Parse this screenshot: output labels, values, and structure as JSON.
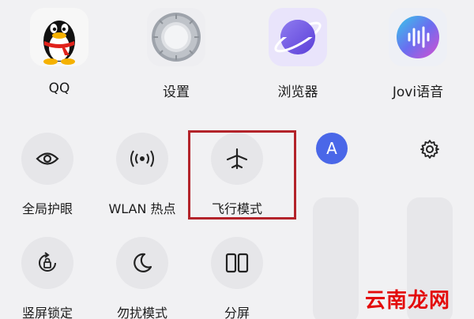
{
  "apps": [
    {
      "label": "QQ",
      "icon": "qq-penguin-icon"
    },
    {
      "label": "设置",
      "icon": "settings-gear-icon"
    },
    {
      "label": "浏览器",
      "icon": "browser-planet-icon"
    },
    {
      "label": "Jovi语音",
      "icon": "jovi-voice-icon"
    }
  ],
  "tiles": [
    {
      "label": "全局护眼",
      "icon": "eye-icon"
    },
    {
      "label": "WLAN 热点",
      "icon": "hotspot-icon"
    },
    {
      "label": "飞行模式",
      "icon": "airplane-icon"
    },
    {
      "label": "竖屏锁定",
      "icon": "rotation-lock-icon"
    },
    {
      "label": "勿扰模式",
      "icon": "moon-icon"
    },
    {
      "label": "分屏",
      "icon": "split-screen-icon"
    }
  ],
  "brightness": {
    "auto_label": "A"
  },
  "watermark": "云南龙网",
  "colors": {
    "highlight": "#b3232a",
    "accent": "#4a67e8",
    "watermark": "#e30b0b"
  }
}
